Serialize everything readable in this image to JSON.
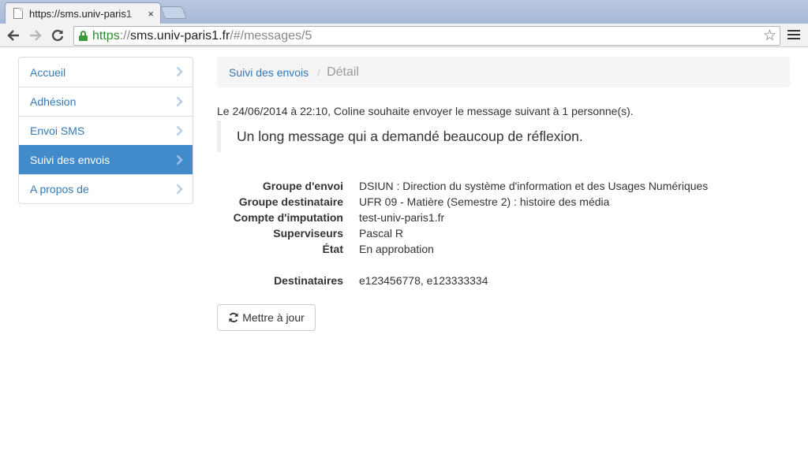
{
  "browser": {
    "tab_title": "https://sms.univ-paris1",
    "tab_close": "×",
    "url_scheme": "https",
    "url_sep": "://",
    "url_host": "sms.univ-paris1.fr",
    "url_path": "/#/messages/5",
    "back_icon": "back-arrow-icon",
    "forward_icon": "forward-arrow-icon",
    "reload_icon": "reload-icon",
    "bookmark_icon": "star-icon",
    "menu_icon": "hamburger-menu-icon"
  },
  "sidebar": {
    "items": [
      {
        "label": "Accueil",
        "active": false
      },
      {
        "label": "Adhésion",
        "active": false
      },
      {
        "label": "Envoi SMS",
        "active": false
      },
      {
        "label": "Suivi des envois",
        "active": true
      },
      {
        "label": "A propos de",
        "active": false
      }
    ]
  },
  "breadcrumb": {
    "link": "Suivi des envois",
    "separator": "/",
    "current": "Détail"
  },
  "message": {
    "intro": "Le 24/06/2014 à 22:10, Coline souhaite envoyer le message suivant à 1 personne(s).",
    "body": "Un long message qui a demandé beaucoup de réflexion."
  },
  "details": [
    {
      "label": "Groupe d'envoi",
      "value": "DSIUN : Direction du système d'information et des Usages Numériques"
    },
    {
      "label": "Groupe destinataire",
      "value": "UFR 09 - Matière (Semestre 2) : histoire des média"
    },
    {
      "label": "Compte d'imputation",
      "value": "test-univ-paris1.fr"
    },
    {
      "label": "Superviseurs",
      "value": "Pascal R"
    },
    {
      "label": "État",
      "value": "En approbation"
    },
    {
      "label": "Destinataires",
      "value": "e123456778, e123333334"
    }
  ],
  "actions": {
    "update_label": "Mettre à jour"
  },
  "colors": {
    "link": "#337ab7",
    "active_nav": "#428bca",
    "secure_green": "#2b8a2b"
  }
}
